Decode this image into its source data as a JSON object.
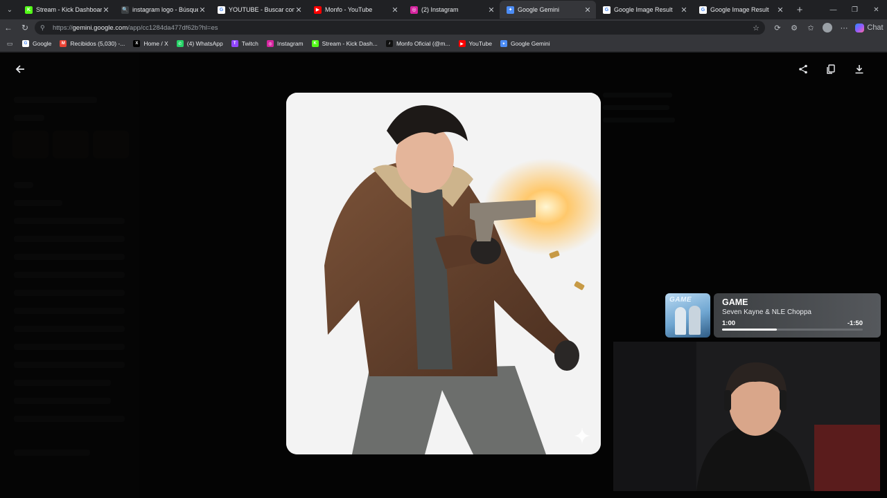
{
  "tabs": [
    {
      "title": "Stream - Kick Dashboard",
      "favicon": "kick-icon",
      "color": "#53fc18",
      "glyph": "K"
    },
    {
      "title": "instagram logo - Búsqueda",
      "favicon": "search-icon",
      "color": "#3c4043",
      "glyph": "🔍"
    },
    {
      "title": "YOUTUBE - Buscar con Goo",
      "favicon": "google-icon",
      "color": "#ffffff",
      "glyph": "G"
    },
    {
      "title": "Monfo - YouTube",
      "favicon": "youtube-icon",
      "color": "#ff0000",
      "glyph": "▶"
    },
    {
      "title": "(2) Instagram",
      "favicon": "instagram-icon",
      "color": "#d6249f",
      "glyph": "◎"
    },
    {
      "title": "Google Gemini",
      "favicon": "gemini-icon",
      "color": "#4c8df6",
      "glyph": "✦",
      "active": true
    },
    {
      "title": "Google Image Result",
      "favicon": "google-icon",
      "color": "#ffffff",
      "glyph": "G"
    },
    {
      "title": "Google Image Result",
      "favicon": "google-icon",
      "color": "#ffffff",
      "glyph": "G"
    }
  ],
  "address": {
    "prefix": "https://",
    "host": "gemini.google.com",
    "path": "/app/cc1284da477df62b?hl=es"
  },
  "toolbar": {
    "copilot_label": "Chat"
  },
  "bookmarks": [
    {
      "label": "Google",
      "favicon": "google-icon",
      "color": "#ffffff",
      "glyph": "G"
    },
    {
      "label": "Recibidos (5,030) -...",
      "favicon": "gmail-icon",
      "color": "#ea4335",
      "glyph": "M"
    },
    {
      "label": "Home / X",
      "favicon": "x-icon",
      "color": "#000000",
      "glyph": "X"
    },
    {
      "label": "(4) WhatsApp",
      "favicon": "whatsapp-icon",
      "color": "#25d366",
      "glyph": "✆"
    },
    {
      "label": "Twitch",
      "favicon": "twitch-icon",
      "color": "#9146ff",
      "glyph": "T"
    },
    {
      "label": "Instagram",
      "favicon": "instagram-icon",
      "color": "#d6249f",
      "glyph": "◎"
    },
    {
      "label": "Stream - Kick Dash...",
      "favicon": "kick-icon",
      "color": "#53fc18",
      "glyph": "K"
    },
    {
      "label": "Monfo Oficial (@m...",
      "favicon": "tiktok-icon",
      "color": "#111111",
      "glyph": "♪"
    },
    {
      "label": "YouTube",
      "favicon": "youtube-icon",
      "color": "#ff0000",
      "glyph": "▶"
    },
    {
      "label": "Google Gemini",
      "favicon": "gemini-icon",
      "color": "#4c8df6",
      "glyph": "✦"
    }
  ],
  "now_playing": {
    "title": "GAME",
    "artist": "Seven Kayne & NLE Choppa",
    "elapsed": "1:00",
    "remaining": "-1:50",
    "progress": 0.39,
    "art_text": "GAME"
  },
  "colors": {
    "page_bg": "#131314",
    "chrome_dark": "#202124",
    "chrome_light": "#35363a"
  }
}
